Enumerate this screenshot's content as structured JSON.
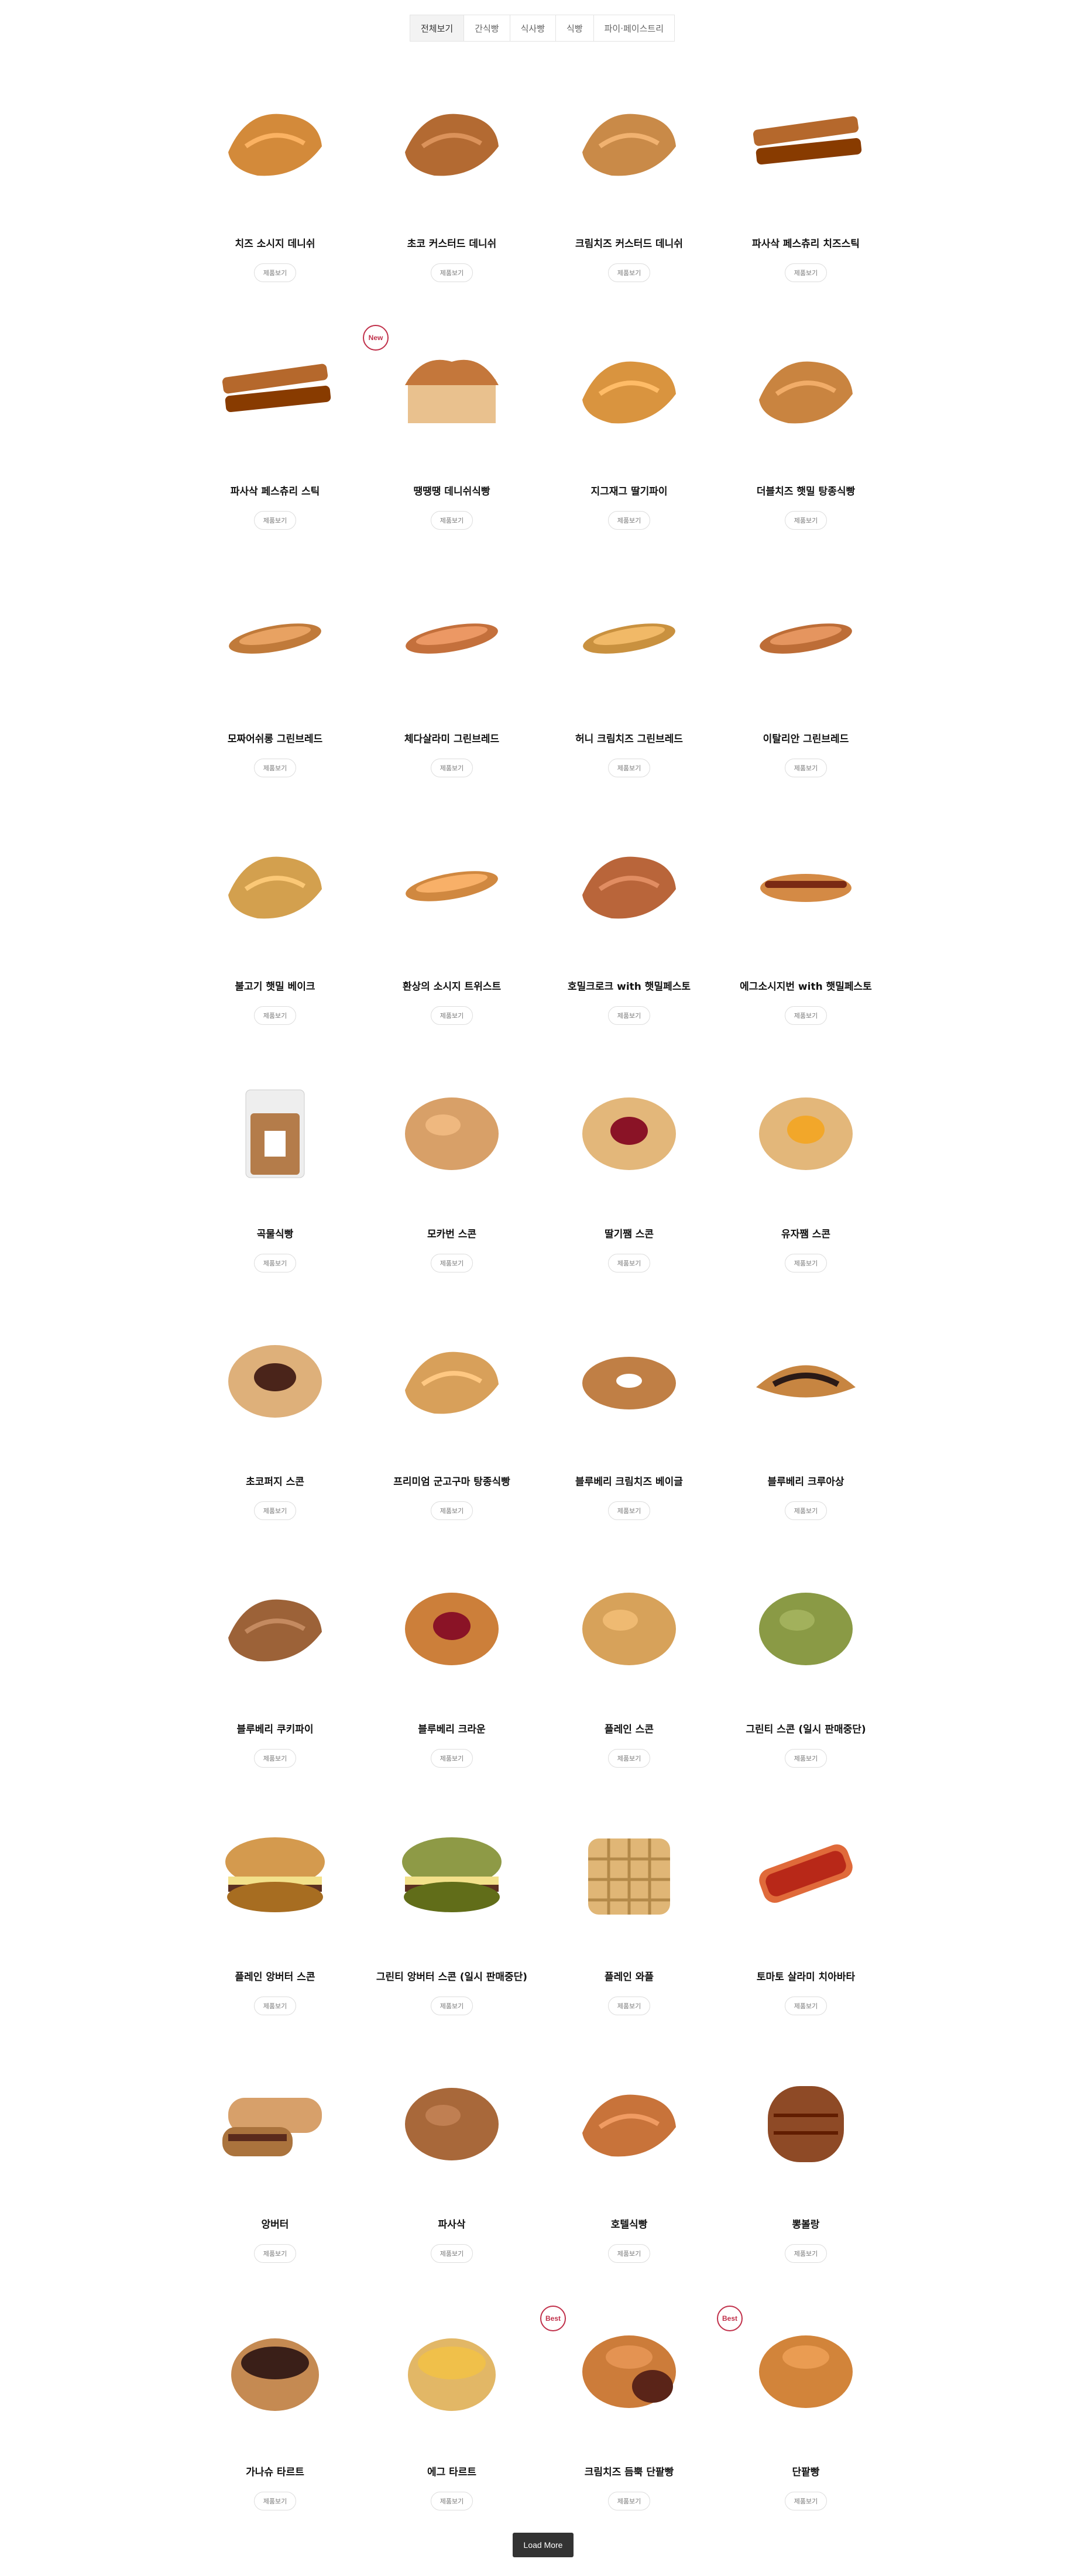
{
  "tabs": [
    {
      "label": "전체보기",
      "active": true
    },
    {
      "label": "간식빵",
      "active": false
    },
    {
      "label": "식사빵",
      "active": false
    },
    {
      "label": "식빵",
      "active": false
    },
    {
      "label": "파이·페이스트리",
      "active": false
    }
  ],
  "detail_label": "제품보기",
  "load_more_label": "Load More",
  "products": [
    {
      "name": "치즈 소시지 데니쉬",
      "icon": "pastry-sausage",
      "color": "#d38a3a"
    },
    {
      "name": "초코 커스터드 데니쉬",
      "icon": "pastry-choco",
      "color": "#b36a32"
    },
    {
      "name": "크림치즈 커스터드 데니쉬",
      "icon": "pastry-cream",
      "color": "#c98a48"
    },
    {
      "name": "파사삭 페스츄리 치즈스틱",
      "icon": "stick",
      "color": "#b5682c"
    },
    {
      "name": "파사삭 페스츄리 스틱",
      "icon": "stick",
      "color": "#b5682c"
    },
    {
      "name": "땡땡땡 데니쉬식빵",
      "icon": "loaf-box",
      "color": "#c4773b",
      "badge": "New"
    },
    {
      "name": "지그재그 딸기파이",
      "icon": "pie",
      "color": "#d9943f"
    },
    {
      "name": "더블치즈 햇밀 탕종식빵",
      "icon": "loaf-cut",
      "color": "#c98440"
    },
    {
      "name": "모짜어쉬롱 그린브레드",
      "icon": "flatbread",
      "color": "#c07a3a"
    },
    {
      "name": "체다살라미 그린브레드",
      "icon": "flatbread",
      "color": "#c4703c"
    },
    {
      "name": "허니 크림치즈 그린브레드",
      "icon": "flatbread",
      "color": "#c9913f"
    },
    {
      "name": "이탈리안 그린브레드",
      "icon": "flatbread",
      "color": "#bd6d37"
    },
    {
      "name": "불고기 햇밀 베이크",
      "icon": "bake-cut",
      "color": "#d3a04e"
    },
    {
      "name": "환상의 소시지 트위스트",
      "icon": "twist",
      "color": "#d08840"
    },
    {
      "name": "호밀크로크 with 햇밀페스토",
      "icon": "square-bake",
      "color": "#b9653a"
    },
    {
      "name": "에그소시지번 with 햇밀페스토",
      "icon": "hotdog",
      "color": "#d48a45"
    },
    {
      "name": "곡물식빵",
      "icon": "bagged-loaf",
      "color": "#b47c4a"
    },
    {
      "name": "모카번 스콘",
      "icon": "round",
      "color": "#d8a068"
    },
    {
      "name": "딸기쨈 스콘",
      "icon": "round-jam",
      "color": "#e3b77a"
    },
    {
      "name": "유자쨈 스콘",
      "icon": "round-yuzu",
      "color": "#e3b77a"
    },
    {
      "name": "초코퍼지 스콘",
      "icon": "round-choco",
      "color": "#deb07a"
    },
    {
      "name": "프리미엄 군고구마 탕종식빵",
      "icon": "loaf",
      "color": "#d8a05a"
    },
    {
      "name": "블루베리 크림치즈 베이글",
      "icon": "bagel",
      "color": "#c07f45"
    },
    {
      "name": "블루베리 크루아상",
      "icon": "croissant",
      "color": "#c78541"
    },
    {
      "name": "블루베리 쿠키파이",
      "icon": "cookie-pie",
      "color": "#9c6238"
    },
    {
      "name": "블루베리 크라운",
      "icon": "round-jam",
      "color": "#cc7f3a"
    },
    {
      "name": "플레인 스콘",
      "icon": "round",
      "color": "#d7a25a"
    },
    {
      "name": "그린티 스콘 (일시 판매중단)",
      "icon": "round-green",
      "color": "#8a9a45"
    },
    {
      "name": "플레인 앙버터 스콘",
      "icon": "sandwich",
      "color": "#d49a4e"
    },
    {
      "name": "그린티 앙버터 스콘 (일시 판매중단)",
      "icon": "sandwich-green",
      "color": "#8e9a46"
    },
    {
      "name": "플레인 와플",
      "icon": "waffle",
      "color": "#e0b676"
    },
    {
      "name": "토마토 살라미 치아바타",
      "icon": "ciabatta",
      "color": "#e06a3a"
    },
    {
      "name": "앙버터",
      "icon": "ang-butter",
      "color": "#d7a06a"
    },
    {
      "name": "파사삭",
      "icon": "dome",
      "color": "#a8683a"
    },
    {
      "name": "호텔식빵",
      "icon": "loaf",
      "color": "#c8733a"
    },
    {
      "name": "뽕볼랑",
      "icon": "roll",
      "color": "#8e4a26"
    },
    {
      "name": "가나슈 타르트",
      "icon": "tart-choco",
      "color": "#c58a52"
    },
    {
      "name": "에그 타르트",
      "icon": "tart-egg",
      "color": "#e2b766"
    },
    {
      "name": "크림치즈 듬뿍 단팥빵",
      "icon": "bun-cut",
      "color": "#cc7c3a",
      "badge": "Best"
    },
    {
      "name": "단팥빵",
      "icon": "bun",
      "color": "#d2843a",
      "badge": "Best"
    }
  ]
}
